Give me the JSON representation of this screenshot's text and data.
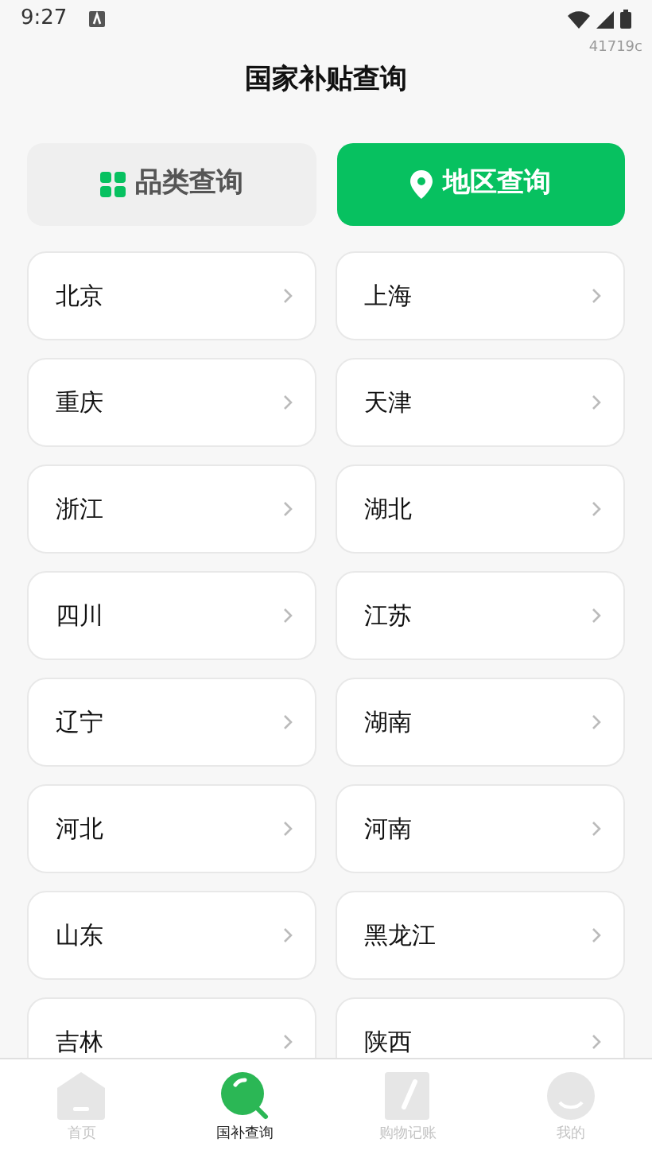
{
  "status_bar": {
    "time": "9:27"
  },
  "build_tag": "41719c",
  "title": "国家补贴查询",
  "tabs": [
    {
      "label": "品类查询",
      "kind": "grid",
      "selected": false
    },
    {
      "label": "地区查询",
      "kind": "pin",
      "selected": true
    }
  ],
  "regions": [
    {
      "name": "北京"
    },
    {
      "name": "上海"
    },
    {
      "name": "重庆"
    },
    {
      "name": "天津"
    },
    {
      "name": "浙江"
    },
    {
      "name": "湖北"
    },
    {
      "name": "四川"
    },
    {
      "name": "江苏"
    },
    {
      "name": "辽宁"
    },
    {
      "name": "湖南"
    },
    {
      "name": "河北"
    },
    {
      "name": "河南"
    },
    {
      "name": "山东"
    },
    {
      "name": "黑龙江"
    },
    {
      "name": "吉林"
    },
    {
      "name": "陕西"
    }
  ],
  "bottom_nav": [
    {
      "label": "首页",
      "kind": "home",
      "selected": false
    },
    {
      "label": "国补查询",
      "kind": "search",
      "selected": true
    },
    {
      "label": "购物记账",
      "kind": "note",
      "selected": false
    },
    {
      "label": "我的",
      "kind": "user",
      "selected": false
    }
  ]
}
